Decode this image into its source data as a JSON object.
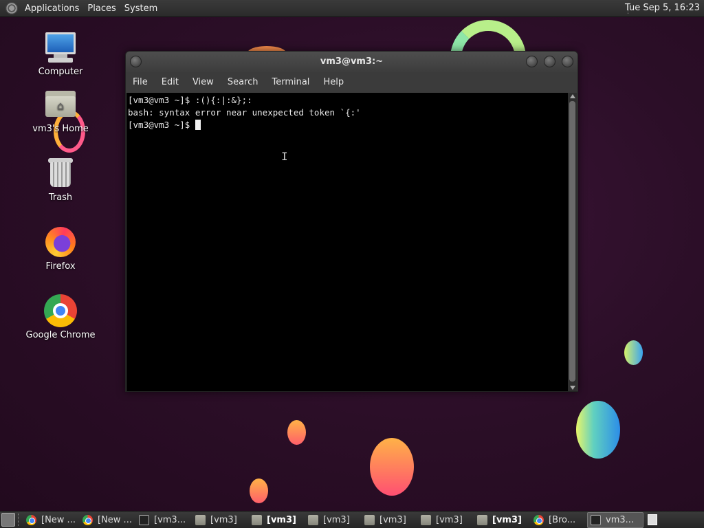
{
  "top_panel": {
    "menus": [
      "Applications",
      "Places",
      "System"
    ],
    "clock": "Tue Sep  5, 16:23"
  },
  "desktop_icons": [
    {
      "label": "Computer",
      "icon": "computer-icon"
    },
    {
      "label": "vm3's Home",
      "icon": "home-folder-icon"
    },
    {
      "label": "Trash",
      "icon": "trash-icon"
    },
    {
      "label": "Firefox",
      "icon": "firefox-icon"
    },
    {
      "label": "Google Chrome",
      "icon": "chrome-icon"
    }
  ],
  "terminal": {
    "title": "vm3@vm3:~",
    "menu": [
      "File",
      "Edit",
      "View",
      "Search",
      "Terminal",
      "Help"
    ],
    "lines": [
      "[vm3@vm3 ~]$ :(){:|:&};:",
      "bash: syntax error near unexpected token `{:'",
      "[vm3@vm3 ~]$ "
    ]
  },
  "taskbar": {
    "tasks": [
      {
        "label": "[New ...",
        "icon": "chrome-icon",
        "bold": false,
        "active": false
      },
      {
        "label": "[New ...",
        "icon": "chrome-icon",
        "bold": false,
        "active": false
      },
      {
        "label": "[vm3...",
        "icon": "terminal-icon",
        "bold": false,
        "active": false
      },
      {
        "label": "[vm3]",
        "icon": "folder-icon",
        "bold": false,
        "active": false
      },
      {
        "label": "[vm3]",
        "icon": "folder-icon",
        "bold": true,
        "active": false
      },
      {
        "label": "[vm3]",
        "icon": "folder-icon",
        "bold": false,
        "active": false
      },
      {
        "label": "[vm3]",
        "icon": "folder-icon",
        "bold": false,
        "active": false
      },
      {
        "label": "[vm3]",
        "icon": "folder-icon",
        "bold": false,
        "active": false
      },
      {
        "label": "[vm3]",
        "icon": "folder-icon",
        "bold": true,
        "active": false
      },
      {
        "label": "[Bro...",
        "icon": "chrome-icon",
        "bold": false,
        "active": false
      },
      {
        "label": "vm3...",
        "icon": "terminal-icon",
        "bold": false,
        "active": true
      }
    ]
  },
  "colors": {
    "desktop_bg": "#2b0e27",
    "panel_bg": "#2f2f2f",
    "terminal_bg": "#000000"
  }
}
